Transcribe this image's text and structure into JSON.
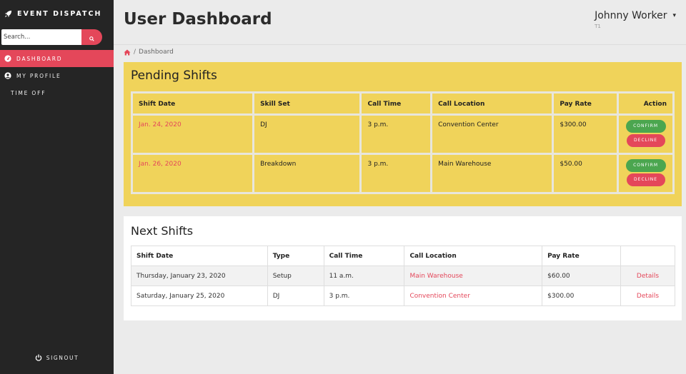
{
  "brand": {
    "name": "EVENT DISPATCH",
    "icon": "rocket-icon"
  },
  "search": {
    "placeholder": "Search...",
    "icon": "search-icon"
  },
  "nav": {
    "dashboard": {
      "label": "DASHBOARD",
      "icon": "tachometer-icon"
    },
    "profile": {
      "label": "MY PROFILE",
      "icon": "user-circle-icon"
    },
    "timeoff": {
      "label": "TIME OFF"
    }
  },
  "signout": {
    "label": "SIGNOUT",
    "icon": "power-icon"
  },
  "header": {
    "title": "User Dashboard"
  },
  "user": {
    "name": "Johnny Worker",
    "role": "T1"
  },
  "breadcrumb": {
    "current": "Dashboard",
    "separator": "/"
  },
  "pending": {
    "title": "Pending Shifts",
    "columns": [
      "Shift Date",
      "Skill Set",
      "Call Time",
      "Call Location",
      "Pay Rate",
      "Action"
    ],
    "rows": [
      {
        "date": "Jan. 24, 2020",
        "skill": "DJ",
        "time": "3 p.m.",
        "location": "Convention Center",
        "pay": "$300.00"
      },
      {
        "date": "Jan. 26, 2020",
        "skill": "Breakdown",
        "time": "3 p.m.",
        "location": "Main Warehouse",
        "pay": "$50.00"
      }
    ],
    "confirm_label": "CONFIRM",
    "decline_label": "DECLINE"
  },
  "next": {
    "title": "Next Shifts",
    "columns": [
      "Shift Date",
      "Type",
      "Call Time",
      "Call Location",
      "Pay Rate",
      ""
    ],
    "rows": [
      {
        "date": "Thursday, January 23, 2020",
        "type": "Setup",
        "time": "11 a.m.",
        "location": "Main Warehouse",
        "pay": "$60.00",
        "link": "Details"
      },
      {
        "date": "Saturday, January 25, 2020",
        "type": "DJ",
        "time": "3 p.m.",
        "location": "Convention Center",
        "pay": "$300.00",
        "link": "Details"
      }
    ]
  },
  "colors": {
    "accent": "#e4475a",
    "sidebar": "#252525",
    "pending_bg": "#f0d35a",
    "confirm": "#4ba64f"
  }
}
